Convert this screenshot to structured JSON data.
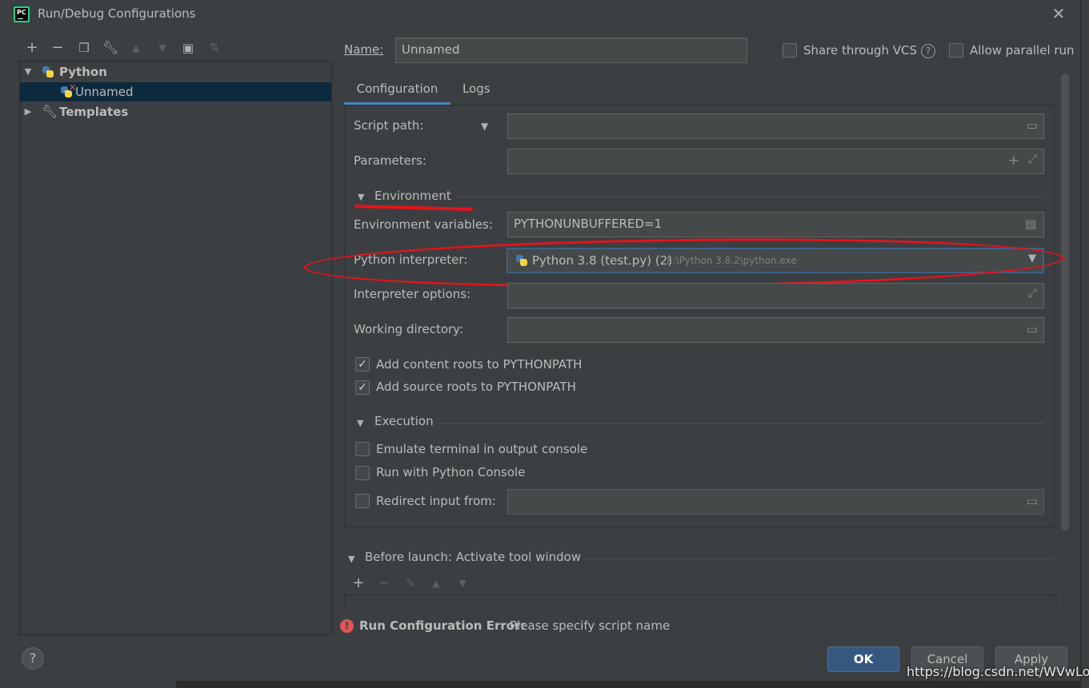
{
  "window": {
    "title": "Run/Debug Configurations",
    "app_icon_text": "PC"
  },
  "toolbar": {
    "icons": [
      "add-icon",
      "remove-icon",
      "copy-icon",
      "wrench-icon",
      "move-up-icon",
      "move-down-icon",
      "new-folder-icon",
      "sort-icon"
    ]
  },
  "tree": {
    "python_label": "Python",
    "unnamed_label": "Unnamed",
    "templates_label": "Templates"
  },
  "header": {
    "name_label": "Name:",
    "name_value": "Unnamed",
    "share_vcs_label": "Share through VCS",
    "allow_parallel_label": "Allow parallel run"
  },
  "tabs": [
    "Configuration",
    "Logs"
  ],
  "form": {
    "script_path_label": "Script path:",
    "script_path_value": "",
    "parameters_label": "Parameters:",
    "parameters_value": "",
    "environment_title": "Environment",
    "env_vars_label": "Environment variables:",
    "env_vars_value": "PYTHONUNBUFFERED=1",
    "interpreter_label": "Python interpreter:",
    "interpreter_name": "Python 3.8 (test.py) (2)",
    "interpreter_path": "E:\\Python 3.8.2\\python.exe",
    "interpreter_options_label": "Interpreter options:",
    "interpreter_options_value": "",
    "working_dir_label": "Working directory:",
    "working_dir_value": "",
    "add_content_roots_label": "Add content roots to PYTHONPATH",
    "add_content_roots_checked": true,
    "add_source_roots_label": "Add source roots to PYTHONPATH",
    "add_source_roots_checked": true,
    "execution_title": "Execution",
    "emulate_terminal_label": "Emulate terminal in output console",
    "emulate_terminal_checked": false,
    "run_python_console_label": "Run with Python Console",
    "run_python_console_checked": false,
    "redirect_input_label": "Redirect input from:",
    "redirect_input_checked": false,
    "redirect_input_value": ""
  },
  "before_launch": {
    "title": "Before launch: Activate tool window"
  },
  "status": {
    "error_title": "Run Configuration Error:",
    "error_message": "Please specify script name"
  },
  "buttons": {
    "ok": "OK",
    "cancel": "Cancel",
    "apply": "Apply",
    "help": "?"
  },
  "watermark": "https://blog.csdn.net/WVwLong",
  "colors": {
    "background": "#3c3f41",
    "field_bg": "#45494a",
    "selection": "#0d293e",
    "accent_blue": "#4a88c7",
    "ok_button": "#365880",
    "error_red": "#e05555",
    "annotation_red": "#e8121b"
  }
}
